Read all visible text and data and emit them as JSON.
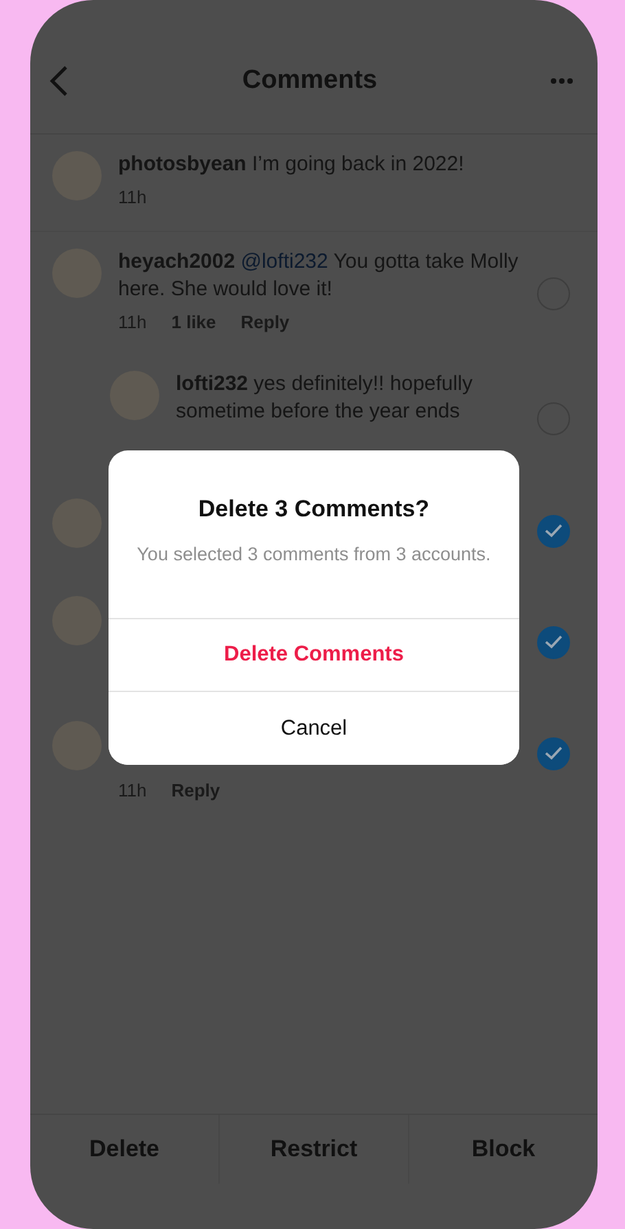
{
  "header": {
    "title": "Comments"
  },
  "comments": [
    {
      "kind": "comment",
      "username": "photosbyean",
      "text": "I’m going back in 2022!",
      "meta": [
        "11h"
      ]
    },
    {
      "kind": "comment",
      "username": "heyach2002",
      "mention": "@lofti232",
      "text": "You gotta take Molly here. She would love it!",
      "meta": [
        "11h",
        "1 like",
        "Reply"
      ],
      "selected": false
    },
    {
      "kind": "reply",
      "username": "lofti232",
      "text": "yes definitely!! hopefully sometime before the year ends",
      "selected": false
    },
    {
      "kind": "hidden",
      "selected": true
    },
    {
      "kind": "hidden",
      "selected": true
    },
    {
      "kind": "hidden",
      "meta": [
        "11h",
        "Reply"
      ],
      "selected": true
    }
  ],
  "dialog": {
    "title": "Delete 3 Comments?",
    "message": "You selected 3 comments from 3 accounts.",
    "actions": [
      {
        "label": "Delete Comments",
        "kind": "destructive"
      },
      {
        "label": "Cancel",
        "kind": "normal"
      }
    ]
  },
  "bottom_bar": [
    "Delete",
    "Restrict",
    "Block"
  ]
}
